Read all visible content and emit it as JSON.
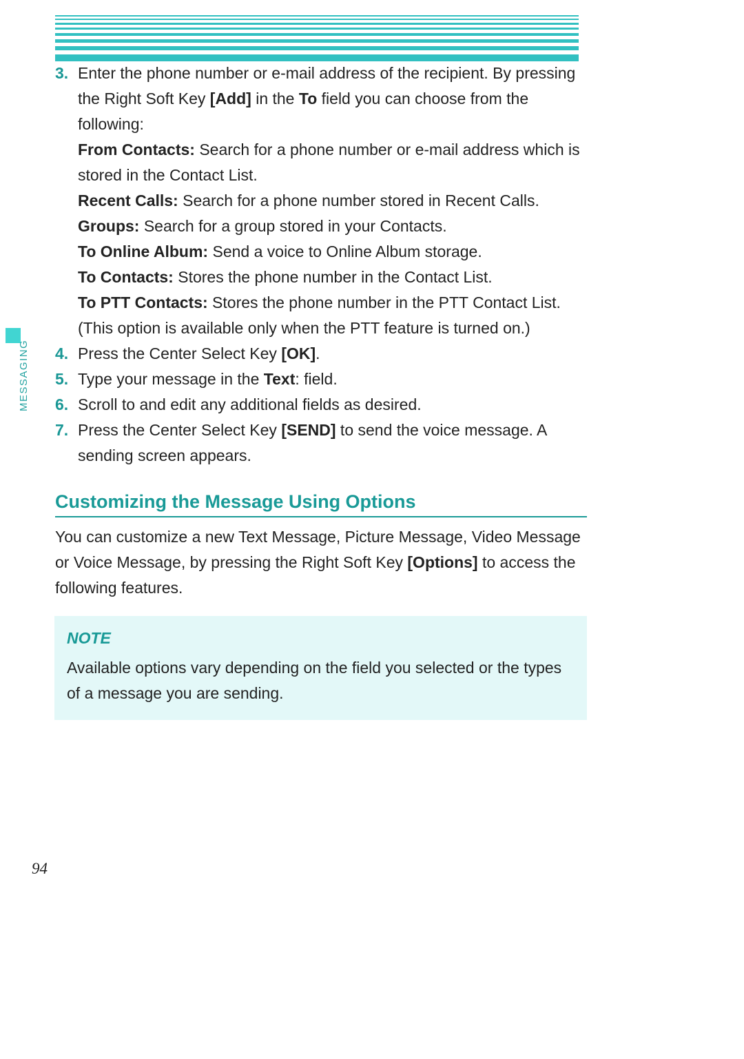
{
  "sidebar": {
    "label": "MESSAGING"
  },
  "steps": {
    "s3": {
      "num": "3.",
      "p1a": "Enter the phone number or e-mail address of the recipient. By pressing the Right Soft Key ",
      "p1_bold1": "[Add]",
      "p1b": " in the ",
      "p1_bold2": "To",
      "p1c": " field you can choose from the following:",
      "fc_label": "From Contacts:",
      "fc_text": " Search for a phone number or e-mail address which is stored in the Contact List.",
      "rc_label": "Recent Calls:",
      "rc_text": " Search for a phone number stored in Recent Calls.",
      "gr_label": "Groups:",
      "gr_text": " Search for a group stored in your Contacts.",
      "oa_label": "To Online Album:",
      "oa_text": " Send a voice to Online Album storage.",
      "tc_label": "To Contacts:",
      "tc_text": " Stores the phone number in the Contact List.",
      "ptt_label": "To PTT Contacts:",
      "ptt_text": " Stores the phone number in the PTT Contact List. (This option is available only when the PTT feature is turned on.)"
    },
    "s4": {
      "num": "4.",
      "a": "Press the Center Select Key ",
      "b": "[OK]",
      "c": "."
    },
    "s5": {
      "num": "5.",
      "a": "Type your message in the ",
      "b": "Text",
      "c": ": field."
    },
    "s6": {
      "num": "6.",
      "a": "Scroll to and edit any additional fields as desired."
    },
    "s7": {
      "num": "7.",
      "a": "Press the Center Select Key ",
      "b": "[SEND]",
      "c": " to send the voice message. A sending screen appears."
    }
  },
  "section": {
    "title": "Customizing the Message Using Options",
    "body_a": "You can customize a new Text Message, Picture Message, Video Message or Voice Message, by pressing the Right Soft Key ",
    "body_b": "[Options]",
    "body_c": " to access the following features."
  },
  "note": {
    "title": "NOTE",
    "body": "Available options vary depending on the field you selected or the types of a message you are sending."
  },
  "page_number": "94"
}
